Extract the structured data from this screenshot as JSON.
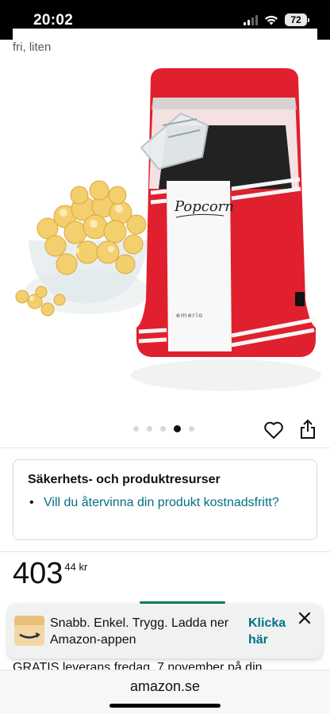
{
  "status_bar": {
    "time": "20:02",
    "battery": "72"
  },
  "product": {
    "title_snippet": "fri, liten",
    "image_alt": "Red popcorn maker with bowl of popcorn",
    "image_label": "Popcorn",
    "brand_mark": "emerio",
    "image_count": 5,
    "active_image_index": 4
  },
  "safety": {
    "title": "Säkerhets- och produktresurser",
    "link": "Vill du återvinna din produkt kostnadsfritt?"
  },
  "price": {
    "whole": "403",
    "fraction": "44 kr"
  },
  "app_banner": {
    "text": "Snabb. Enkel. Trygg. Ladda ner Amazon-appen",
    "link": "Klicka här"
  },
  "delivery": {
    "text": "GRATIS leverans fredag, 7 november på din"
  },
  "browser": {
    "url": "amazon.se"
  },
  "colors": {
    "link": "#007185",
    "brand_red": "#e0202e",
    "green": "#067d62"
  }
}
